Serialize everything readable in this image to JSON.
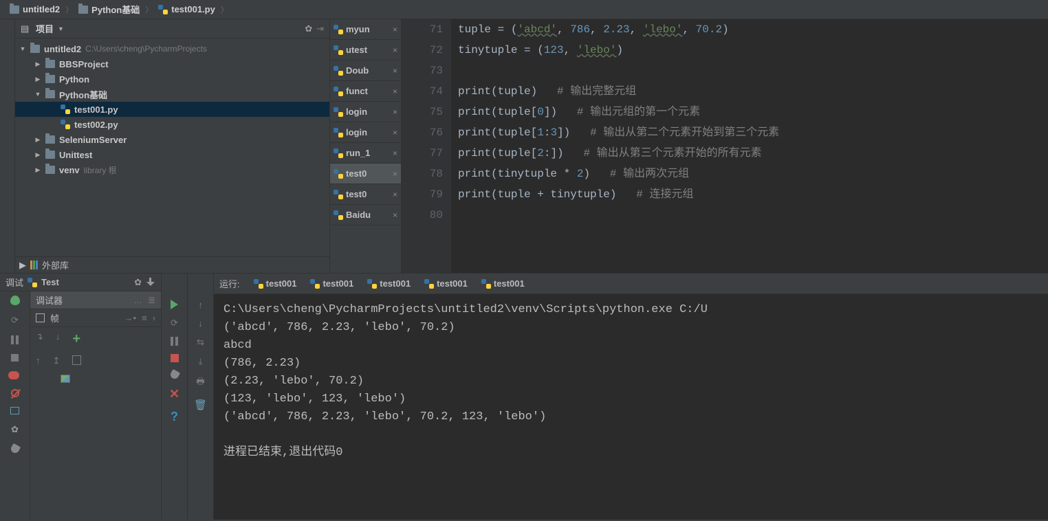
{
  "breadcrumb": [
    {
      "label": "untitled2",
      "type": "folder"
    },
    {
      "label": "Python基础",
      "type": "folder"
    },
    {
      "label": "test001.py",
      "type": "py"
    }
  ],
  "projectPanel": {
    "title": "项目",
    "rootName": "untitled2",
    "rootPath": "C:\\Users\\cheng\\PycharmProjects",
    "tree": [
      {
        "indent": 1,
        "label": "BBSProject",
        "arrow": "▶",
        "icon": "folder"
      },
      {
        "indent": 1,
        "label": "Python",
        "arrow": "▶",
        "icon": "folder"
      },
      {
        "indent": 1,
        "label": "Python基础",
        "arrow": "▼",
        "icon": "folder"
      },
      {
        "indent": 2,
        "label": "test001.py",
        "arrow": "",
        "icon": "py",
        "selected": true
      },
      {
        "indent": 2,
        "label": "test002.py",
        "arrow": "",
        "icon": "py"
      },
      {
        "indent": 1,
        "label": "SeleniumServer",
        "arrow": "▶",
        "icon": "folder"
      },
      {
        "indent": 1,
        "label": "Unittest",
        "arrow": "▶",
        "icon": "folder"
      },
      {
        "indent": 1,
        "label": "venv",
        "arrow": "▶",
        "icon": "folder",
        "suffix": "library 根"
      }
    ],
    "externalLibs": "外部库"
  },
  "editorTabs": [
    {
      "label": "myun"
    },
    {
      "label": "utest"
    },
    {
      "label": "Doub"
    },
    {
      "label": "funct"
    },
    {
      "label": "login"
    },
    {
      "label": "login"
    },
    {
      "label": "run_1"
    },
    {
      "label": "test0",
      "active": true
    },
    {
      "label": "test0"
    },
    {
      "label": "Baidu"
    }
  ],
  "code": {
    "startLine": 71,
    "lines": [
      [
        {
          "t": "tuple = (",
          "c": "id"
        },
        {
          "t": "'abcd'",
          "c": "str"
        },
        {
          "t": ", ",
          "c": "op"
        },
        {
          "t": "786",
          "c": "num"
        },
        {
          "t": ", ",
          "c": "op"
        },
        {
          "t": "2.23",
          "c": "num"
        },
        {
          "t": ", ",
          "c": "op"
        },
        {
          "t": "'lebo'",
          "c": "str"
        },
        {
          "t": ", ",
          "c": "op"
        },
        {
          "t": "70.2",
          "c": "num"
        },
        {
          "t": ")",
          "c": "op"
        }
      ],
      [
        {
          "t": "tinytuple = (",
          "c": "id"
        },
        {
          "t": "123",
          "c": "num"
        },
        {
          "t": ", ",
          "c": "op"
        },
        {
          "t": "'lebo'",
          "c": "str"
        },
        {
          "t": ")",
          "c": "op"
        }
      ],
      [],
      [
        {
          "t": "print",
          "c": "fn"
        },
        {
          "t": "(tuple)   ",
          "c": "id"
        },
        {
          "t": "# 输出完整元组",
          "c": "cmt"
        }
      ],
      [
        {
          "t": "print",
          "c": "fn"
        },
        {
          "t": "(tuple[",
          "c": "id"
        },
        {
          "t": "0",
          "c": "num"
        },
        {
          "t": "])   ",
          "c": "id"
        },
        {
          "t": "# 输出元组的第一个元素",
          "c": "cmt"
        }
      ],
      [
        {
          "t": "print",
          "c": "fn"
        },
        {
          "t": "(tuple[",
          "c": "id"
        },
        {
          "t": "1",
          "c": "num"
        },
        {
          "t": ":",
          "c": "op"
        },
        {
          "t": "3",
          "c": "num"
        },
        {
          "t": "])   ",
          "c": "id"
        },
        {
          "t": "# 输出从第二个元素开始到第三个元素",
          "c": "cmt"
        }
      ],
      [
        {
          "t": "print",
          "c": "fn"
        },
        {
          "t": "(tuple[",
          "c": "id"
        },
        {
          "t": "2",
          "c": "num"
        },
        {
          "t": ":])   ",
          "c": "id"
        },
        {
          "t": "# 输出从第三个元素开始的所有元素",
          "c": "cmt"
        }
      ],
      [
        {
          "t": "print",
          "c": "fn"
        },
        {
          "t": "(tinytuple * ",
          "c": "id"
        },
        {
          "t": "2",
          "c": "num"
        },
        {
          "t": ")   ",
          "c": "id"
        },
        {
          "t": "# 输出两次元组",
          "c": "cmt"
        }
      ],
      [
        {
          "t": "print",
          "c": "fn"
        },
        {
          "t": "(tuple + tinytuple)   ",
          "c": "id"
        },
        {
          "t": "# 连接元组",
          "c": "cmt"
        }
      ],
      []
    ]
  },
  "debug": {
    "title": "调试",
    "config": "Test",
    "debuggerTab": "调试器",
    "framesLabel": "帧"
  },
  "run": {
    "title": "运行:",
    "tabs": [
      "test001",
      "test001",
      "test001",
      "test001",
      "test001"
    ],
    "output": [
      "C:\\Users\\cheng\\PycharmProjects\\untitled2\\venv\\Scripts\\python.exe C:/U",
      "('abcd', 786, 2.23, 'lebo', 70.2)",
      "abcd",
      "(786, 2.23)",
      "(2.23, 'lebo', 70.2)",
      "(123, 'lebo', 123, 'lebo')",
      "('abcd', 786, 2.23, 'lebo', 70.2, 123, 'lebo')",
      "",
      "进程已结束,退出代码0"
    ]
  }
}
